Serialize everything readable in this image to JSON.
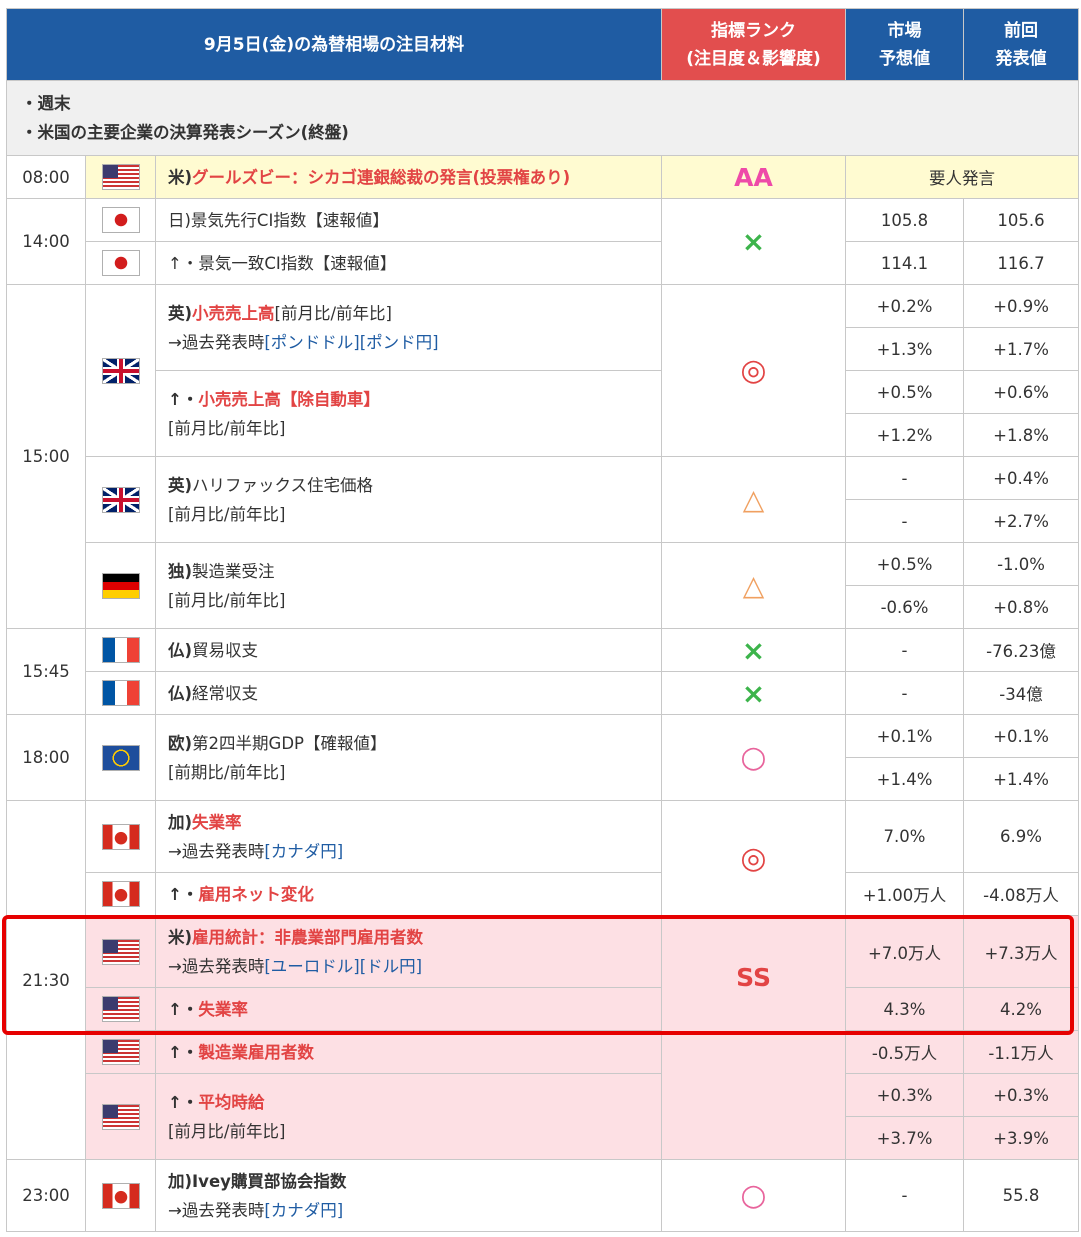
{
  "header": {
    "title": "9月5日(金)の為替相場の注目材料",
    "rank_label": "指標ランク",
    "rank_sub": "(注目度＆影響度)",
    "forecast_1": "市場",
    "forecast_2": "予想値",
    "previous_1": "前回",
    "previous_2": "発表値"
  },
  "notes": [
    "・週末",
    "・米国の主要企業の決算発表シーズン(終盤)"
  ],
  "rows": {
    "r0800": {
      "time": "08:00",
      "flag": "us-flag-icon",
      "prefix": "米)",
      "name": "グールズビー：シカゴ連銀総裁の発言(投票権あり)",
      "rank": "AA",
      "remark": "要人発言"
    },
    "r1400a": {
      "time": "14:00",
      "flag": "jp-flag-icon",
      "name": "日)景気先行CI指数【速報値】",
      "rank": "×",
      "f": "105.8",
      "p": "105.6"
    },
    "r1400b": {
      "flag": "jp-flag-icon",
      "name": "↑・景気一致CI指数【速報値】",
      "f": "114.1",
      "p": "116.7"
    },
    "uk_retail": {
      "time": "15:00",
      "flag": "uk-flag-icon",
      "prefix": "英)",
      "name": "小売売上高",
      "bracket": "[前月比/前年比]",
      "past": "→過去発表時",
      "link1": "[ポンドドル]",
      "link2": "[ポンド円]",
      "rank": "◎",
      "v": [
        [
          "+0.2%",
          "+0.9%"
        ],
        [
          "+1.3%",
          "+1.7%"
        ]
      ]
    },
    "uk_retail_ex": {
      "arrow": "↑・",
      "name": "小売売上高【除自動車】",
      "bracket": "[前月比/前年比]",
      "v": [
        [
          "+0.5%",
          "+0.6%"
        ],
        [
          "+1.2%",
          "+1.8%"
        ]
      ]
    },
    "halifax": {
      "flag": "uk-flag-icon",
      "prefix": "英)",
      "name": "ハリファックス住宅価格",
      "bracket": "[前月比/前年比]",
      "rank": "△",
      "v": [
        [
          "-",
          "+0.4%"
        ],
        [
          "-",
          "+2.7%"
        ]
      ]
    },
    "de_orders": {
      "flag": "de-flag-icon",
      "prefix": "独)",
      "name": "製造業受注",
      "bracket": "[前月比/前年比]",
      "rank": "△",
      "v": [
        [
          "+0.5%",
          "-1.0%"
        ],
        [
          "-0.6%",
          "+0.8%"
        ]
      ]
    },
    "fr_trade": {
      "time": "15:45",
      "flag": "fr-flag-icon",
      "prefix": "仏)",
      "name": "貿易収支",
      "rank": "×",
      "f": "-",
      "p": "-76.23億"
    },
    "fr_current": {
      "flag": "fr-flag-icon",
      "prefix": "仏)",
      "name": "経常収支",
      "rank": "×",
      "f": "-",
      "p": "-34億"
    },
    "eu_gdp": {
      "time": "18:00",
      "flag": "eu-flag-icon",
      "prefix": "欧)",
      "name": "第2四半期GDP【確報値】",
      "bracket": "[前期比/前年比]",
      "rank": "○",
      "v": [
        [
          "+0.1%",
          "+0.1%"
        ],
        [
          "+1.4%",
          "+1.4%"
        ]
      ]
    },
    "ca_unemp": {
      "time": "21:30",
      "flag": "ca-flag-icon",
      "prefix": "加)",
      "name": "失業率",
      "past": "→過去発表時",
      "link1": "[カナダ円]",
      "rank": "◎",
      "f": "7.0%",
      "p": "6.9%"
    },
    "ca_emp": {
      "flag": "ca-flag-icon",
      "arrow": "↑・",
      "name": "雇用ネット変化",
      "f": "+1.00万人",
      "p": "-4.08万人"
    },
    "us_nfp": {
      "flag": "us-flag-icon",
      "prefix": "米)",
      "name": "雇用統計：非農業部門雇用者数",
      "past": "→過去発表時",
      "link1": "[ユーロドル]",
      "link2": "[ドル円]",
      "rank": "SS",
      "f": "+7.0万人",
      "p": "+7.3万人"
    },
    "us_unemp": {
      "flag": "us-flag-icon",
      "arrow": "↑・",
      "name": "失業率",
      "f": "4.3%",
      "p": "4.2%"
    },
    "us_mfg": {
      "flag": "us-flag-icon",
      "arrow": "↑・",
      "name": "製造業雇用者数",
      "f": "-0.5万人",
      "p": "-1.1万人"
    },
    "us_wage": {
      "flag": "us-flag-icon",
      "arrow": "↑・",
      "name": "平均時給",
      "bracket": "[前月比/前年比]",
      "v": [
        [
          "+0.3%",
          "+0.3%"
        ],
        [
          "+3.7%",
          "+3.9%"
        ]
      ]
    },
    "ivey": {
      "time": "23:00",
      "flag": "ca-flag-icon",
      "prefix": "加)",
      "name": "Ivey購買部協会指数",
      "past": "→過去発表時",
      "link1": "[カナダ円]",
      "rank": "○",
      "f": "-",
      "p": "55.8"
    }
  }
}
